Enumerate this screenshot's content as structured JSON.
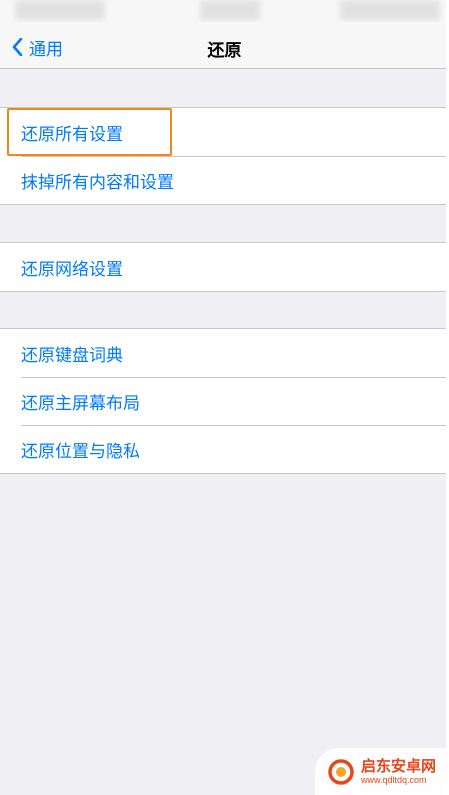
{
  "nav": {
    "back_label": "通用",
    "title": "还原"
  },
  "groups": [
    {
      "items": [
        "还原所有设置",
        "抹掉所有内容和设置"
      ]
    },
    {
      "items": [
        "还原网络设置"
      ]
    },
    {
      "items": [
        "还原键盘词典",
        "还原主屏幕布局",
        "还原位置与隐私"
      ]
    }
  ],
  "highlighted_item": "还原所有设置",
  "colors": {
    "accent": "#007aff",
    "highlight": "#f0871e",
    "background": "#efeff4",
    "watermark": "#e8461b"
  },
  "watermark": {
    "name": "启东安卓网",
    "url": "www.qdltdq.com",
    "icon": "watermark-logo-icon"
  }
}
